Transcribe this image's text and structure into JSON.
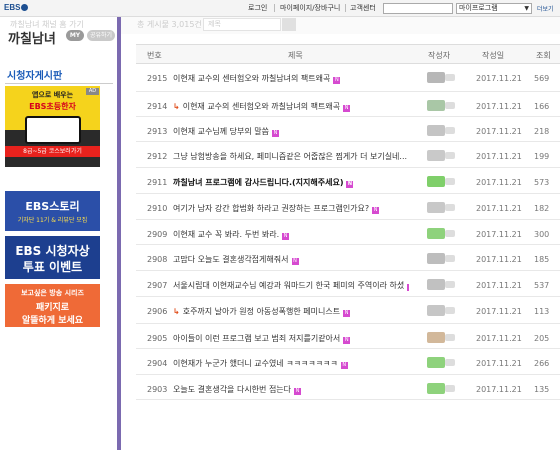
{
  "topbar": {
    "logo": "EBS",
    "links": [
      "로그인",
      "마이페이지/장바구니",
      "고객센터"
    ],
    "search_value": "",
    "select_value": "마이프로그램",
    "more_label": "더보기"
  },
  "sidebar": {
    "ghost_title": "까칠남녀 채널 홈 가기",
    "show_title": "까칠남녀",
    "my_label": "MY",
    "share_label": "공유하기",
    "board_title": "시청자게시판",
    "ads": {
      "ad_badge": "AD",
      "ad1_line1": "앱으로 배우는",
      "ad1_line2": "EBS초등한자",
      "ad1_bar": "8급~5급 코스보러가기",
      "ad2_line1": "EBS스토리",
      "ad2_line2": "기자단 11기 & 리뷰단 모집",
      "ad3_line1": "EBS 시청자상",
      "ad3_line2": "투표 이벤트",
      "ad4_line1": "보고싶은 방송 시리즈",
      "ad4_line2": "패키지로",
      "ad4_line3": "알뜰하게 보세요"
    }
  },
  "searchstrip": {
    "count_text": "총 게시물 3,015건",
    "search_placeholder": "제목"
  },
  "table": {
    "headers": {
      "num": "번호",
      "title": "제목",
      "author": "작성자",
      "date": "작성일",
      "views": "조회"
    },
    "rows": [
      {
        "num": "2915",
        "title": "이현재 교수의 센터험오와 까칠남녀의 팩트왜곡",
        "reply": false,
        "bold": false,
        "date": "2017.11.21",
        "views": "569",
        "author_color": "#b7b7b7"
      },
      {
        "num": "2914",
        "title": "이현재 교수의 센터험오와 까칠남녀의 팩트왜곡",
        "reply": true,
        "bold": false,
        "date": "2017.11.21",
        "views": "166",
        "author_color": "#a9c7a6"
      },
      {
        "num": "2913",
        "title": "이현재 교수님께 당부의 말씀",
        "reply": false,
        "bold": false,
        "date": "2017.11.21",
        "views": "218",
        "author_color": "#c4c4c4"
      },
      {
        "num": "2912",
        "title": "그냥 남험방송을 하세요, 페미니즘같은 어줍잖은 찜게가 더 보기실네...",
        "reply": false,
        "bold": false,
        "date": "2017.11.21",
        "views": "199",
        "author_color": "#c9c9c9"
      },
      {
        "num": "2911",
        "title": "까칠남녀 프로그램에 감사드립니다.(지지해주세요)",
        "reply": false,
        "bold": true,
        "date": "2017.11.21",
        "views": "573",
        "author_color": "#7fcf6a"
      },
      {
        "num": "2910",
        "title": "여기가 남자 강간 합법화 하라고 권장하는 프로그램인가요?",
        "reply": false,
        "bold": false,
        "date": "2017.11.21",
        "views": "182",
        "author_color": "#c8c8c8"
      },
      {
        "num": "2909",
        "title": "이현재 교수 꼭 봐라. 두번 봐라.",
        "reply": false,
        "bold": false,
        "date": "2017.11.21",
        "views": "300",
        "author_color": "#8ed27c"
      },
      {
        "num": "2908",
        "title": "고맙다 오늘도 결혼생각접게해줘서",
        "reply": false,
        "bold": false,
        "date": "2017.11.21",
        "views": "185",
        "author_color": "#bdbdbd"
      },
      {
        "num": "2907",
        "title": "서울시립대 이현재교수님 예강과 워마드기 한국 페미의 주역이라 하셨",
        "reply": false,
        "bold": false,
        "date": "2017.11.21",
        "views": "537",
        "author_color": "#c1c1c1"
      },
      {
        "num": "2906",
        "title": "호주까지 날아가 원정 아동성폭행한 페미니스트",
        "reply": true,
        "bold": false,
        "date": "2017.11.21",
        "views": "113",
        "author_color": "#c6c6c6"
      },
      {
        "num": "2905",
        "title": "아이들이 이런 프로그램 보고 범죄 저지를기같아서",
        "reply": false,
        "bold": false,
        "date": "2017.11.21",
        "views": "205",
        "author_color": "#d2b89a"
      },
      {
        "num": "2904",
        "title": "이현재가 누군가 했더니 교수였네 ㅋㅋㅋㅋㅋㅋㅋ",
        "reply": false,
        "bold": false,
        "date": "2017.11.21",
        "views": "266",
        "author_color": "#8ed27c"
      },
      {
        "num": "2903",
        "title": "오늘도 결혼생각을 다시한번 접는다",
        "reply": false,
        "bold": false,
        "date": "2017.11.21",
        "views": "135",
        "author_color": "#8ed27c"
      }
    ]
  }
}
